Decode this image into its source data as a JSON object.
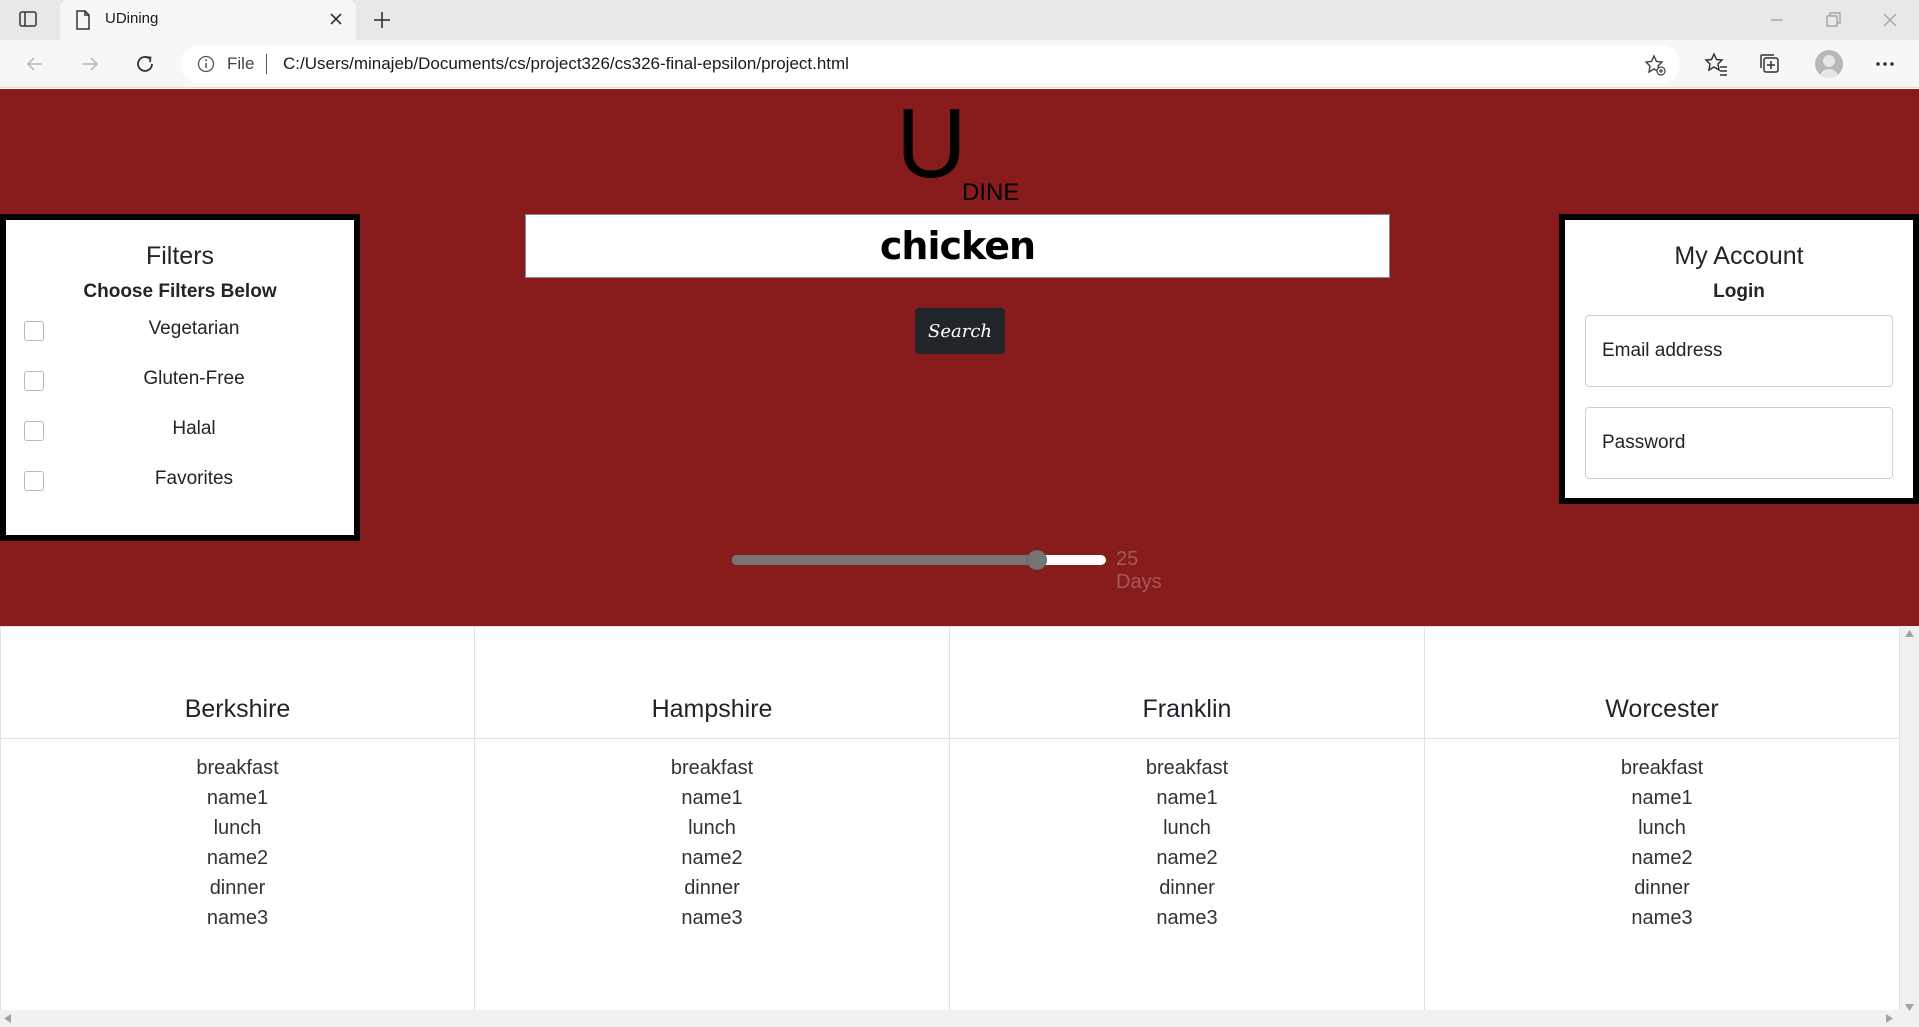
{
  "browser": {
    "tab_title": "UDining",
    "file_label": "File",
    "url": "C:/Users/minajeb/Documents/cs/project326/cs326-final-epsilon/project.html"
  },
  "logo": {
    "big_letter": "U",
    "suffix": "DINE"
  },
  "search": {
    "query": "chicken",
    "button_label": "Search"
  },
  "slider": {
    "value": 25,
    "min": 0,
    "max": 30,
    "value_text": "25 Days"
  },
  "filters": {
    "title": "Filters",
    "subtitle": "Choose Filters Below",
    "options": [
      {
        "label": "Vegetarian",
        "checked": false
      },
      {
        "label": "Gluten-Free",
        "checked": false
      },
      {
        "label": "Halal",
        "checked": false
      },
      {
        "label": "Favorites",
        "checked": false
      }
    ]
  },
  "account": {
    "title": "My Account",
    "subtitle": "Login",
    "email_placeholder": "Email address",
    "password_placeholder": "Password"
  },
  "halls": [
    {
      "name": "Berkshire",
      "lines": [
        "breakfast",
        "name1",
        "lunch",
        "name2",
        "dinner",
        "name3"
      ]
    },
    {
      "name": "Hampshire",
      "lines": [
        "breakfast",
        "name1",
        "lunch",
        "name2",
        "dinner",
        "name3"
      ]
    },
    {
      "name": "Franklin",
      "lines": [
        "breakfast",
        "name1",
        "lunch",
        "name2",
        "dinner",
        "name3"
      ]
    },
    {
      "name": "Worcester",
      "lines": [
        "breakfast",
        "name1",
        "lunch",
        "name2",
        "dinner",
        "name3"
      ]
    }
  ],
  "colors": {
    "hero_bg": "#881c1c",
    "search_button_bg": "#212529",
    "panel_border": "#000000"
  }
}
